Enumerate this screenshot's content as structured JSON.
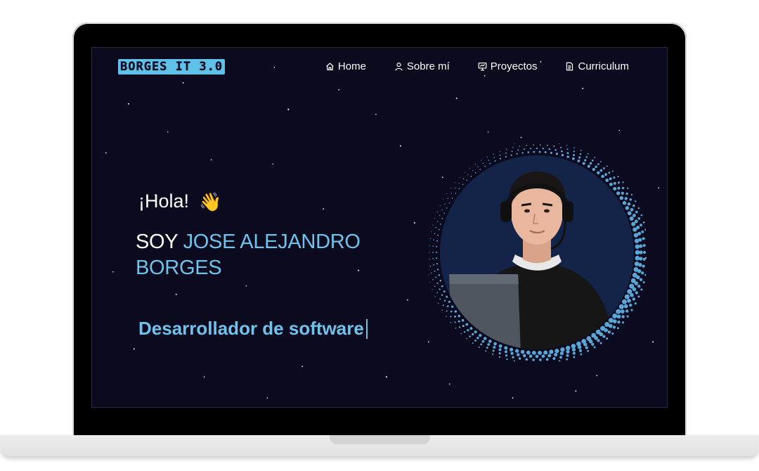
{
  "header": {
    "logo_text": "BORGES IT 3.0",
    "nav": [
      {
        "label": "Home",
        "icon": "home-icon"
      },
      {
        "label": "Sobre mí",
        "icon": "user-icon"
      },
      {
        "label": "Proyectos",
        "icon": "presentation-icon"
      },
      {
        "label": "Curriculum",
        "icon": "document-icon"
      }
    ]
  },
  "hero": {
    "greeting": "¡Hola!",
    "wave_emoji": "👋",
    "intro_prefix": "SOY ",
    "name": "JOSE ALEJANDRO BORGES",
    "typed_text": "Desarrollador de software"
  },
  "colors": {
    "background": "#0b0a1e",
    "accent": "#6fc3ea",
    "text": "#ffffff"
  }
}
